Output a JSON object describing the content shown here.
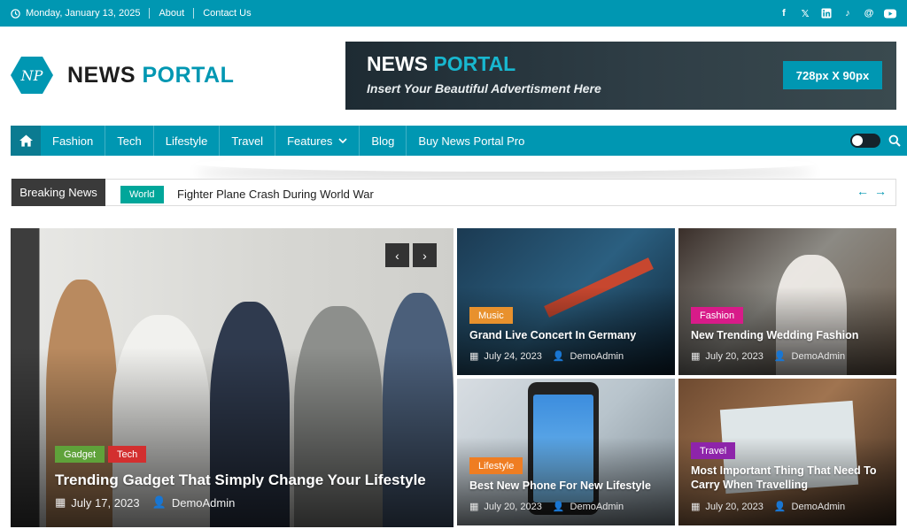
{
  "topbar": {
    "date": "Monday, January 13, 2025",
    "links": [
      "About",
      "Contact Us"
    ],
    "social": [
      "facebook-icon",
      "x-icon",
      "linkedin-icon",
      "tiktok-icon",
      "threads-icon",
      "youtube-icon"
    ]
  },
  "header": {
    "logo_mark": "NP",
    "logo_news": "NEWS",
    "logo_portal": "PORTAL",
    "ad_news": "NEWS",
    "ad_portal": "PORTAL",
    "ad_tagline": "Insert Your Beautiful Advertisment Here",
    "ad_size": "728px X 90px"
  },
  "nav": {
    "items": [
      "Fashion",
      "Tech",
      "Lifestyle",
      "Travel",
      "Features",
      "Blog",
      "Buy News Portal Pro"
    ]
  },
  "breaking": {
    "label": "Breaking News",
    "category": "World",
    "headline": "Fighter Plane Crash During World War"
  },
  "feature": {
    "badges": [
      "Gadget",
      "Tech"
    ],
    "title": "Trending Gadget That Simply Change Your Lifestyle",
    "date": "July 17, 2023",
    "author": "DemoAdmin"
  },
  "cards": [
    {
      "category": "Music",
      "title": "Grand Live Concert In Germany",
      "date": "July 24, 2023",
      "author": "DemoAdmin"
    },
    {
      "category": "Fashion",
      "title": "New Trending Wedding Fashion",
      "date": "July 20, 2023",
      "author": "DemoAdmin"
    },
    {
      "category": "Lifestyle",
      "title": "Best New Phone For New Lifestyle",
      "date": "July 20, 2023",
      "author": "DemoAdmin"
    },
    {
      "category": "Travel",
      "title": "Most Important Thing That Need To Carry When Travelling",
      "date": "July 20, 2023",
      "author": "DemoAdmin"
    }
  ],
  "colors": {
    "brand": "#0097b2",
    "gadget": "#5fa23a",
    "tech": "#d32f2f",
    "music": "#e8912d",
    "fashion": "#d81b89",
    "lifestyle": "#ef7d22",
    "travel": "#8e24aa",
    "world": "#00a69a"
  }
}
